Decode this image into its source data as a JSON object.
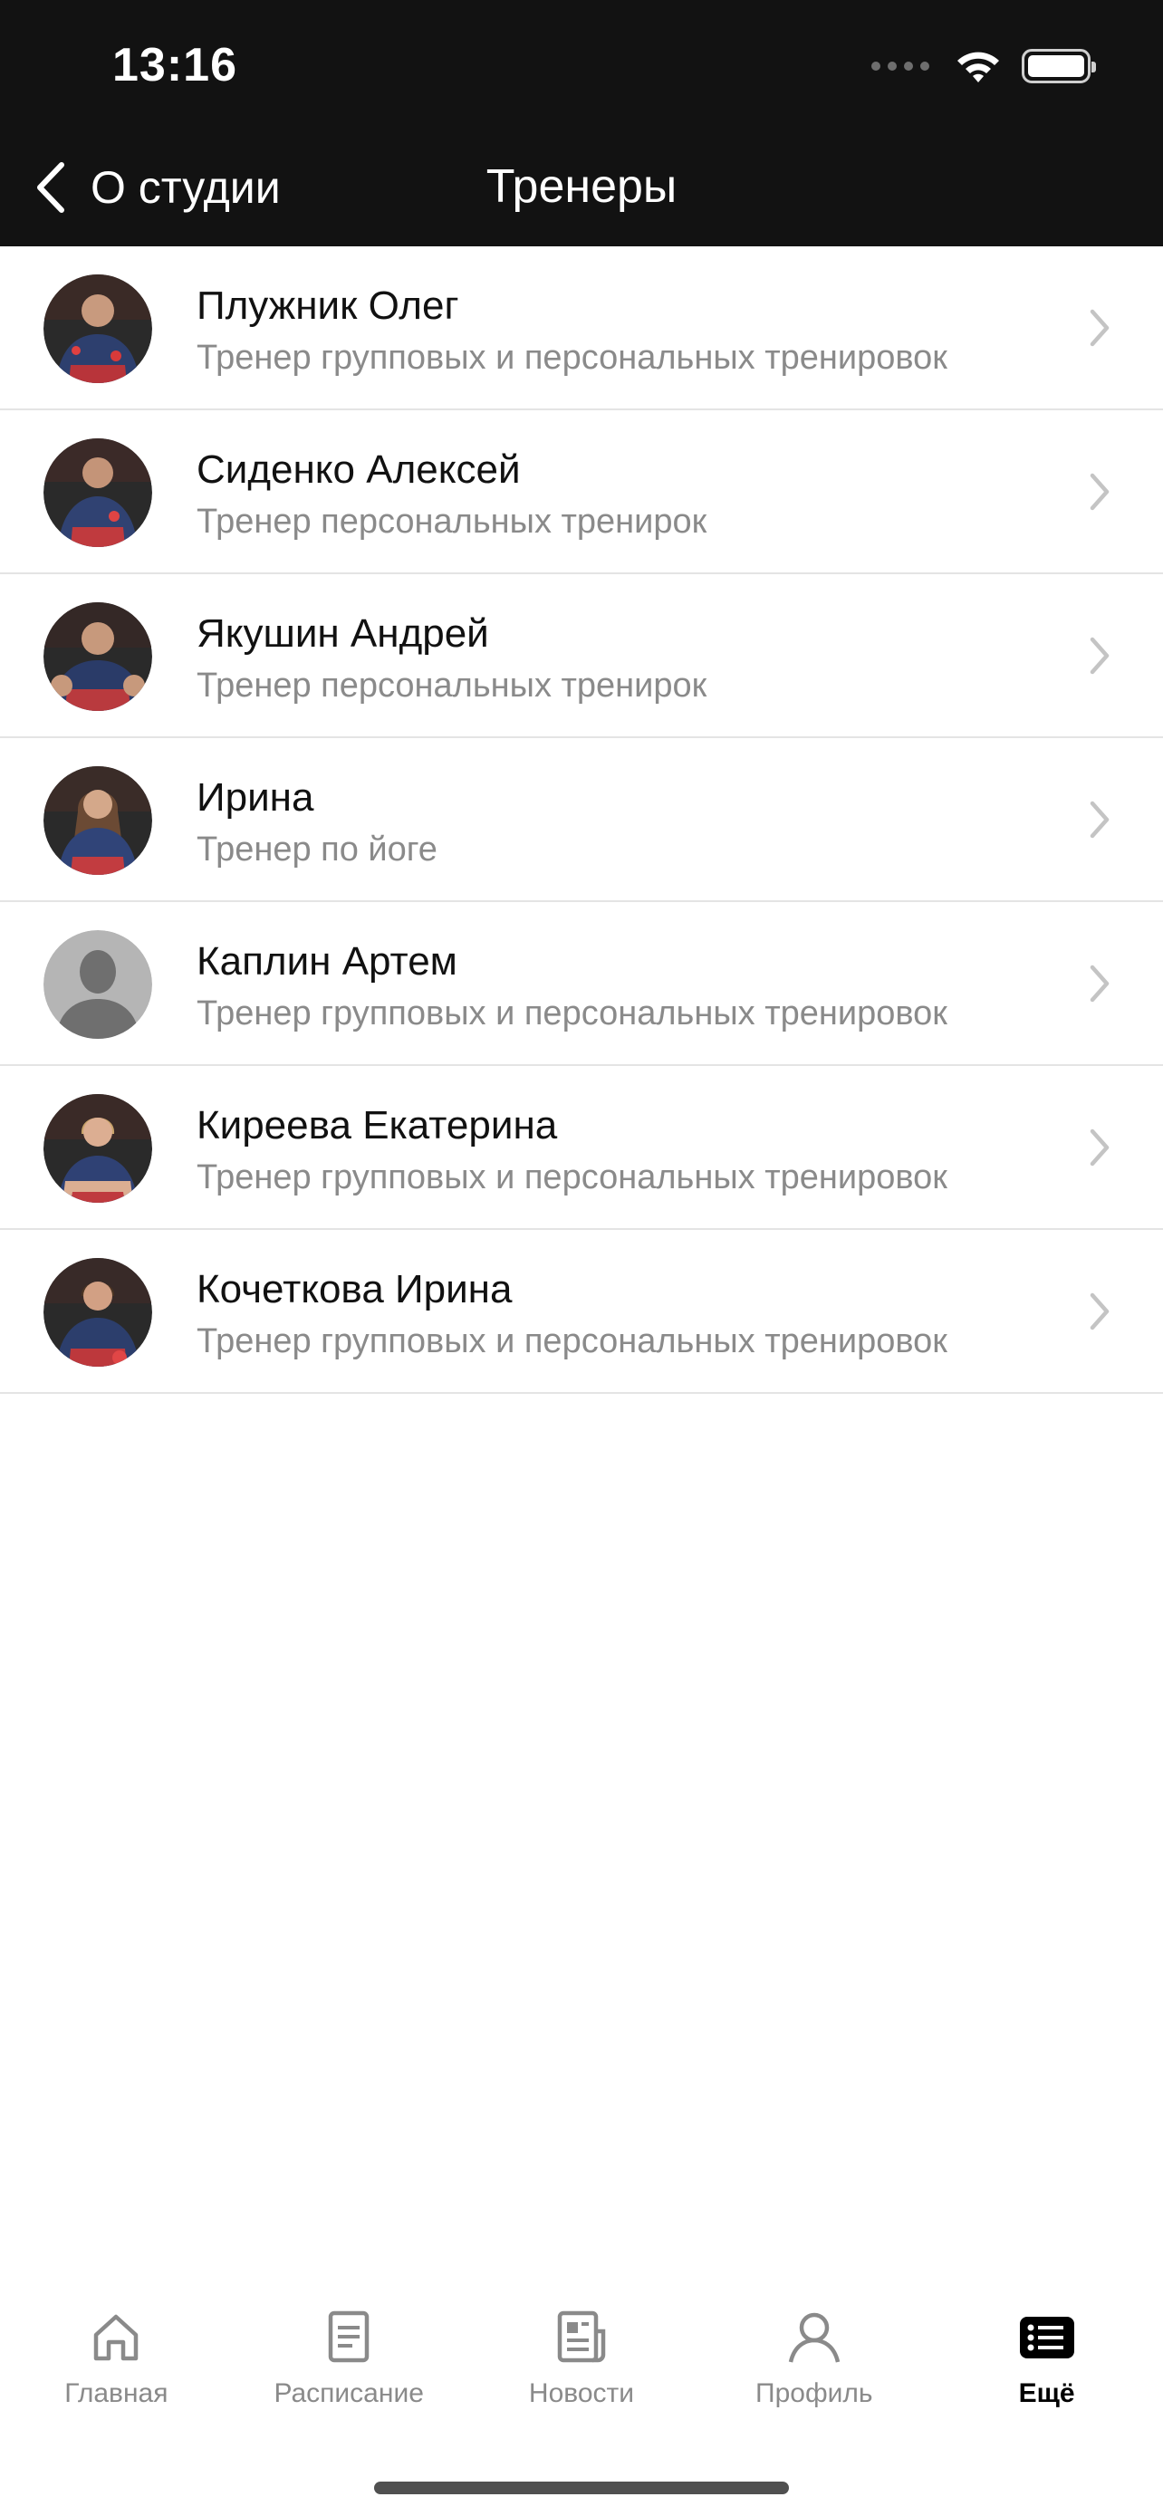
{
  "status_bar": {
    "time": "13:16"
  },
  "nav": {
    "back_label": "О студии",
    "title": "Тренеры"
  },
  "trainers": [
    {
      "name": "Плужник Олег",
      "role": "Тренер групповых и персональных тренировок",
      "avatar": "photo-avatar"
    },
    {
      "name": "Сиденко Алексей",
      "role": "Тренер персональных тренирок",
      "avatar": "photo-avatar"
    },
    {
      "name": "Якушин Андрей",
      "role": "Тренер персональных тренирок",
      "avatar": "photo-avatar"
    },
    {
      "name": "Ирина",
      "role": "Тренер по йоге",
      "avatar": "photo-avatar"
    },
    {
      "name": "Каплин Артем",
      "role": "Тренер групповых и персональных тренировок",
      "avatar": "placeholder-avatar"
    },
    {
      "name": "Киреева Екатерина",
      "role": "Тренер групповых и персональных тренировок",
      "avatar": "photo-avatar"
    },
    {
      "name": "Кочеткова Ирина",
      "role": "Тренер групповых и персональных тренировок",
      "avatar": "photo-avatar"
    }
  ],
  "tabbar": {
    "items": [
      {
        "label": "Главная",
        "icon": "home-icon"
      },
      {
        "label": "Расписание",
        "icon": "schedule-icon"
      },
      {
        "label": "Новости",
        "icon": "news-icon"
      },
      {
        "label": "Профиль",
        "icon": "profile-icon"
      },
      {
        "label": "Ещё",
        "icon": "more-icon"
      }
    ],
    "active_index": 4
  },
  "colors": {
    "header_bg": "#121212",
    "secondary_text": "#8a8a8a",
    "separator": "#e4e4e4"
  }
}
